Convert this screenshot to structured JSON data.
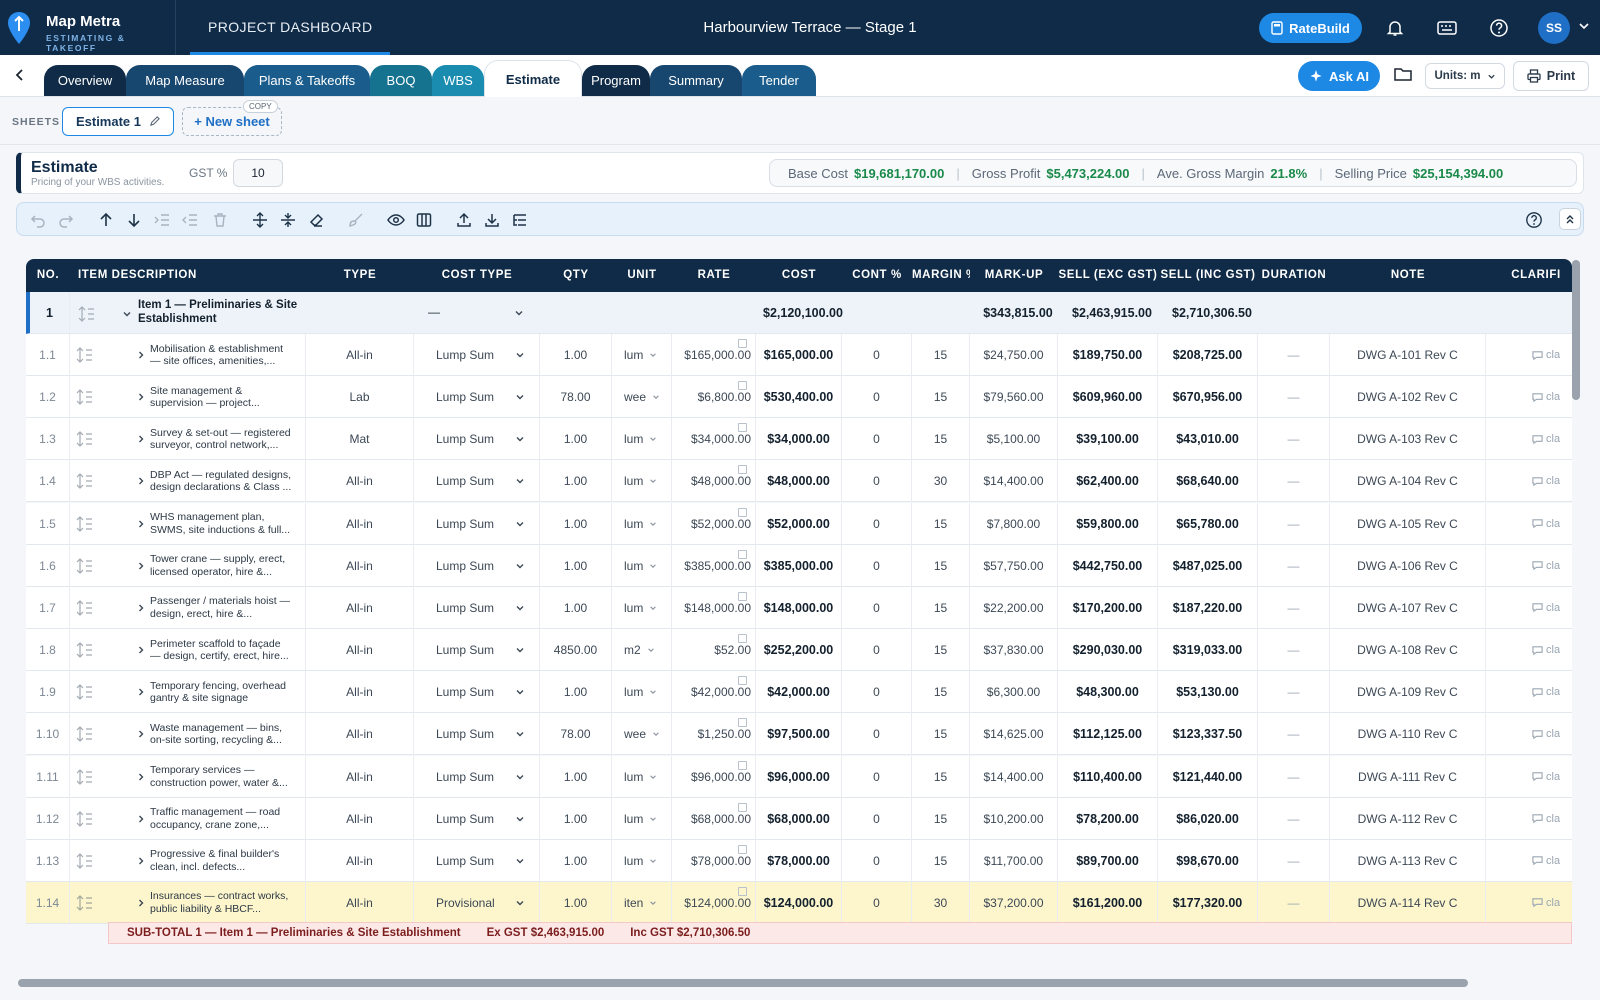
{
  "app": {
    "name": "Map Metra",
    "subtitle": "ESTIMATING & TAKEOFF"
  },
  "header": {
    "section": "PROJECT DASHBOARD",
    "project_title": "Harbourview Terrace — Stage 1",
    "ratebuild_label": "RateBuild",
    "avatar_initials": "SS"
  },
  "tabs": [
    {
      "label": "Overview",
      "color": "#0f2b47"
    },
    {
      "label": "Map Measure",
      "color": "#17466f"
    },
    {
      "label": "Plans & Takeoffs",
      "color": "#1a5d8c"
    },
    {
      "label": "BOQ",
      "color": "#15738f"
    },
    {
      "label": "WBS",
      "color": "#1a8cb0"
    },
    {
      "label": "Estimate",
      "active": true
    },
    {
      "label": "Program",
      "color": "#0f2b47"
    },
    {
      "label": "Summary",
      "color": "#17466f"
    },
    {
      "label": "Tender",
      "color": "#1a5d8c"
    }
  ],
  "actions": {
    "ask_ai": "Ask AI",
    "units": "Units: m",
    "print": "Print"
  },
  "sheets": {
    "label": "SHEETS",
    "current": "Estimate 1",
    "new_sheet": "+ New sheet",
    "copy_badge": "COPY"
  },
  "estimate": {
    "title": "Estimate",
    "subtitle": "Pricing of your WBS activities.",
    "gst_label": "GST %",
    "gst_value": "10",
    "summary": {
      "base_cost_label": "Base Cost",
      "base_cost": "$19,681,170.00",
      "gross_profit_label": "Gross Profit",
      "gross_profit": "$5,473,224.00",
      "margin_label": "Ave. Gross Margin",
      "margin": "21.8%",
      "selling_label": "Selling Price",
      "selling": "$25,154,394.00"
    }
  },
  "columns": [
    "NO.",
    "ITEM DESCRIPTION",
    "TYPE",
    "COST TYPE",
    "QTY",
    "UNIT",
    "RATE",
    "COST",
    "CONT %",
    "MARGIN %",
    "MARK-UP",
    "SELL (EXC GST)",
    "SELL (INC GST)",
    "DURATION",
    "NOTE",
    "CLARIFI"
  ],
  "group": {
    "no": "1",
    "desc": "Item 1 — Preliminaries & Site Establishment",
    "cost_type": "—",
    "cost": "$2,120,100.00",
    "markup": "$343,815.00",
    "sell_ex": "$2,463,915.00",
    "sell_inc": "$2,710,306.50"
  },
  "rows": [
    {
      "no": "1.1",
      "desc1": "Mobilisation & establishment",
      "desc2": "— site offices, amenities,...",
      "type": "All-in",
      "cost_type": "Lump Sum",
      "qty": "1.00",
      "unit": "lum",
      "rate": "$165,000.00",
      "cost": "$165,000.00",
      "cont": "0",
      "margin": "15",
      "markup": "$24,750.00",
      "sell_ex": "$189,750.00",
      "sell_inc": "$208,725.00",
      "duration": "—",
      "note": "DWG A-101 Rev C",
      "clar": "cla"
    },
    {
      "no": "1.2",
      "desc1": "Site management &",
      "desc2": "supervision — project...",
      "type": "Lab",
      "cost_type": "Lump Sum",
      "qty": "78.00",
      "unit": "wee",
      "rate": "$6,800.00",
      "cost": "$530,400.00",
      "cont": "0",
      "margin": "15",
      "markup": "$79,560.00",
      "sell_ex": "$609,960.00",
      "sell_inc": "$670,956.00",
      "duration": "—",
      "note": "DWG A-102 Rev C",
      "clar": "cla"
    },
    {
      "no": "1.3",
      "desc1": "Survey & set-out — registered",
      "desc2": "surveyor, control network,...",
      "type": "Mat",
      "cost_type": "Lump Sum",
      "qty": "1.00",
      "unit": "lum",
      "rate": "$34,000.00",
      "cost": "$34,000.00",
      "cont": "0",
      "margin": "15",
      "markup": "$5,100.00",
      "sell_ex": "$39,100.00",
      "sell_inc": "$43,010.00",
      "duration": "—",
      "note": "DWG A-103 Rev C",
      "clar": "cla"
    },
    {
      "no": "1.4",
      "desc1": "DBP Act — regulated designs,",
      "desc2": "design declarations & Class ...",
      "type": "All-in",
      "cost_type": "Lump Sum",
      "qty": "1.00",
      "unit": "lum",
      "rate": "$48,000.00",
      "cost": "$48,000.00",
      "cont": "0",
      "margin": "30",
      "markup": "$14,400.00",
      "sell_ex": "$62,400.00",
      "sell_inc": "$68,640.00",
      "duration": "—",
      "note": "DWG A-104 Rev C",
      "clar": "cla"
    },
    {
      "no": "1.5",
      "desc1": "WHS management plan,",
      "desc2": "SWMS, site inductions & full...",
      "type": "All-in",
      "cost_type": "Lump Sum",
      "qty": "1.00",
      "unit": "lum",
      "rate": "$52,000.00",
      "cost": "$52,000.00",
      "cont": "0",
      "margin": "15",
      "markup": "$7,800.00",
      "sell_ex": "$59,800.00",
      "sell_inc": "$65,780.00",
      "duration": "—",
      "note": "DWG A-105 Rev C",
      "clar": "cla"
    },
    {
      "no": "1.6",
      "desc1": "Tower crane — supply, erect,",
      "desc2": "licensed operator, hire &...",
      "type": "All-in",
      "cost_type": "Lump Sum",
      "qty": "1.00",
      "unit": "lum",
      "rate": "$385,000.00",
      "cost": "$385,000.00",
      "cont": "0",
      "margin": "15",
      "markup": "$57,750.00",
      "sell_ex": "$442,750.00",
      "sell_inc": "$487,025.00",
      "duration": "—",
      "note": "DWG A-106 Rev C",
      "clar": "cla"
    },
    {
      "no": "1.7",
      "desc1": "Passenger / materials hoist —",
      "desc2": "design, erect, hire &...",
      "type": "All-in",
      "cost_type": "Lump Sum",
      "qty": "1.00",
      "unit": "lum",
      "rate": "$148,000.00",
      "cost": "$148,000.00",
      "cont": "0",
      "margin": "15",
      "markup": "$22,200.00",
      "sell_ex": "$170,200.00",
      "sell_inc": "$187,220.00",
      "duration": "—",
      "note": "DWG A-107 Rev C",
      "clar": "cla"
    },
    {
      "no": "1.8",
      "desc1": "Perimeter scaffold to façade",
      "desc2": "— design, certify, erect, hire...",
      "type": "All-in",
      "cost_type": "Lump Sum",
      "qty": "4850.00",
      "unit": "m2",
      "rate": "$52.00",
      "cost": "$252,200.00",
      "cont": "0",
      "margin": "15",
      "markup": "$37,830.00",
      "sell_ex": "$290,030.00",
      "sell_inc": "$319,033.00",
      "duration": "—",
      "note": "DWG A-108 Rev C",
      "clar": "cla"
    },
    {
      "no": "1.9",
      "desc1": "Temporary fencing, overhead",
      "desc2": "gantry & site signage",
      "type": "All-in",
      "cost_type": "Lump Sum",
      "qty": "1.00",
      "unit": "lum",
      "rate": "$42,000.00",
      "cost": "$42,000.00",
      "cont": "0",
      "margin": "15",
      "markup": "$6,300.00",
      "sell_ex": "$48,300.00",
      "sell_inc": "$53,130.00",
      "duration": "—",
      "note": "DWG A-109 Rev C",
      "clar": "cla"
    },
    {
      "no": "1.10",
      "desc1": "Waste management — bins,",
      "desc2": "on-site sorting, recycling &...",
      "type": "All-in",
      "cost_type": "Lump Sum",
      "qty": "78.00",
      "unit": "wee",
      "rate": "$1,250.00",
      "cost": "$97,500.00",
      "cont": "0",
      "margin": "15",
      "markup": "$14,625.00",
      "sell_ex": "$112,125.00",
      "sell_inc": "$123,337.50",
      "duration": "—",
      "note": "DWG A-110 Rev C",
      "clar": "cla"
    },
    {
      "no": "1.11",
      "desc1": "Temporary services —",
      "desc2": "construction power, water &...",
      "type": "All-in",
      "cost_type": "Lump Sum",
      "qty": "1.00",
      "unit": "lum",
      "rate": "$96,000.00",
      "cost": "$96,000.00",
      "cont": "0",
      "margin": "15",
      "markup": "$14,400.00",
      "sell_ex": "$110,400.00",
      "sell_inc": "$121,440.00",
      "duration": "—",
      "note": "DWG A-111 Rev C",
      "clar": "cla"
    },
    {
      "no": "1.12",
      "desc1": "Traffic management — road",
      "desc2": "occupancy, crane zone,...",
      "type": "All-in",
      "cost_type": "Lump Sum",
      "qty": "1.00",
      "unit": "lum",
      "rate": "$68,000.00",
      "cost": "$68,000.00",
      "cont": "0",
      "margin": "15",
      "markup": "$10,200.00",
      "sell_ex": "$78,200.00",
      "sell_inc": "$86,020.00",
      "duration": "—",
      "note": "DWG A-112 Rev C",
      "clar": "cla"
    },
    {
      "no": "1.13",
      "desc1": "Progressive & final builder's",
      "desc2": "clean, incl. defects...",
      "type": "All-in",
      "cost_type": "Lump Sum",
      "qty": "1.00",
      "unit": "lum",
      "rate": "$78,000.00",
      "cost": "$78,000.00",
      "cont": "0",
      "margin": "15",
      "markup": "$11,700.00",
      "sell_ex": "$89,700.00",
      "sell_inc": "$98,670.00",
      "duration": "—",
      "note": "DWG A-113 Rev C",
      "clar": "cla"
    },
    {
      "no": "1.14",
      "desc1": "Insurances — contract works,",
      "desc2": "public liability & HBCF...",
      "type": "All-in",
      "cost_type": "Provisional",
      "qty": "1.00",
      "unit": "iten",
      "rate": "$124,000.00",
      "cost": "$124,000.00",
      "cont": "0",
      "margin": "30",
      "markup": "$37,200.00",
      "sell_ex": "$161,200.00",
      "sell_inc": "$177,320.00",
      "duration": "—",
      "note": "DWG A-114 Rev C",
      "clar": "cla",
      "highlight": true
    }
  ],
  "subtotal": {
    "label": "SUB-TOTAL 1 — Item 1 — Preliminaries & Site Establishment",
    "ex": "Ex GST $2,463,915.00",
    "inc": "Inc GST $2,710,306.50"
  }
}
